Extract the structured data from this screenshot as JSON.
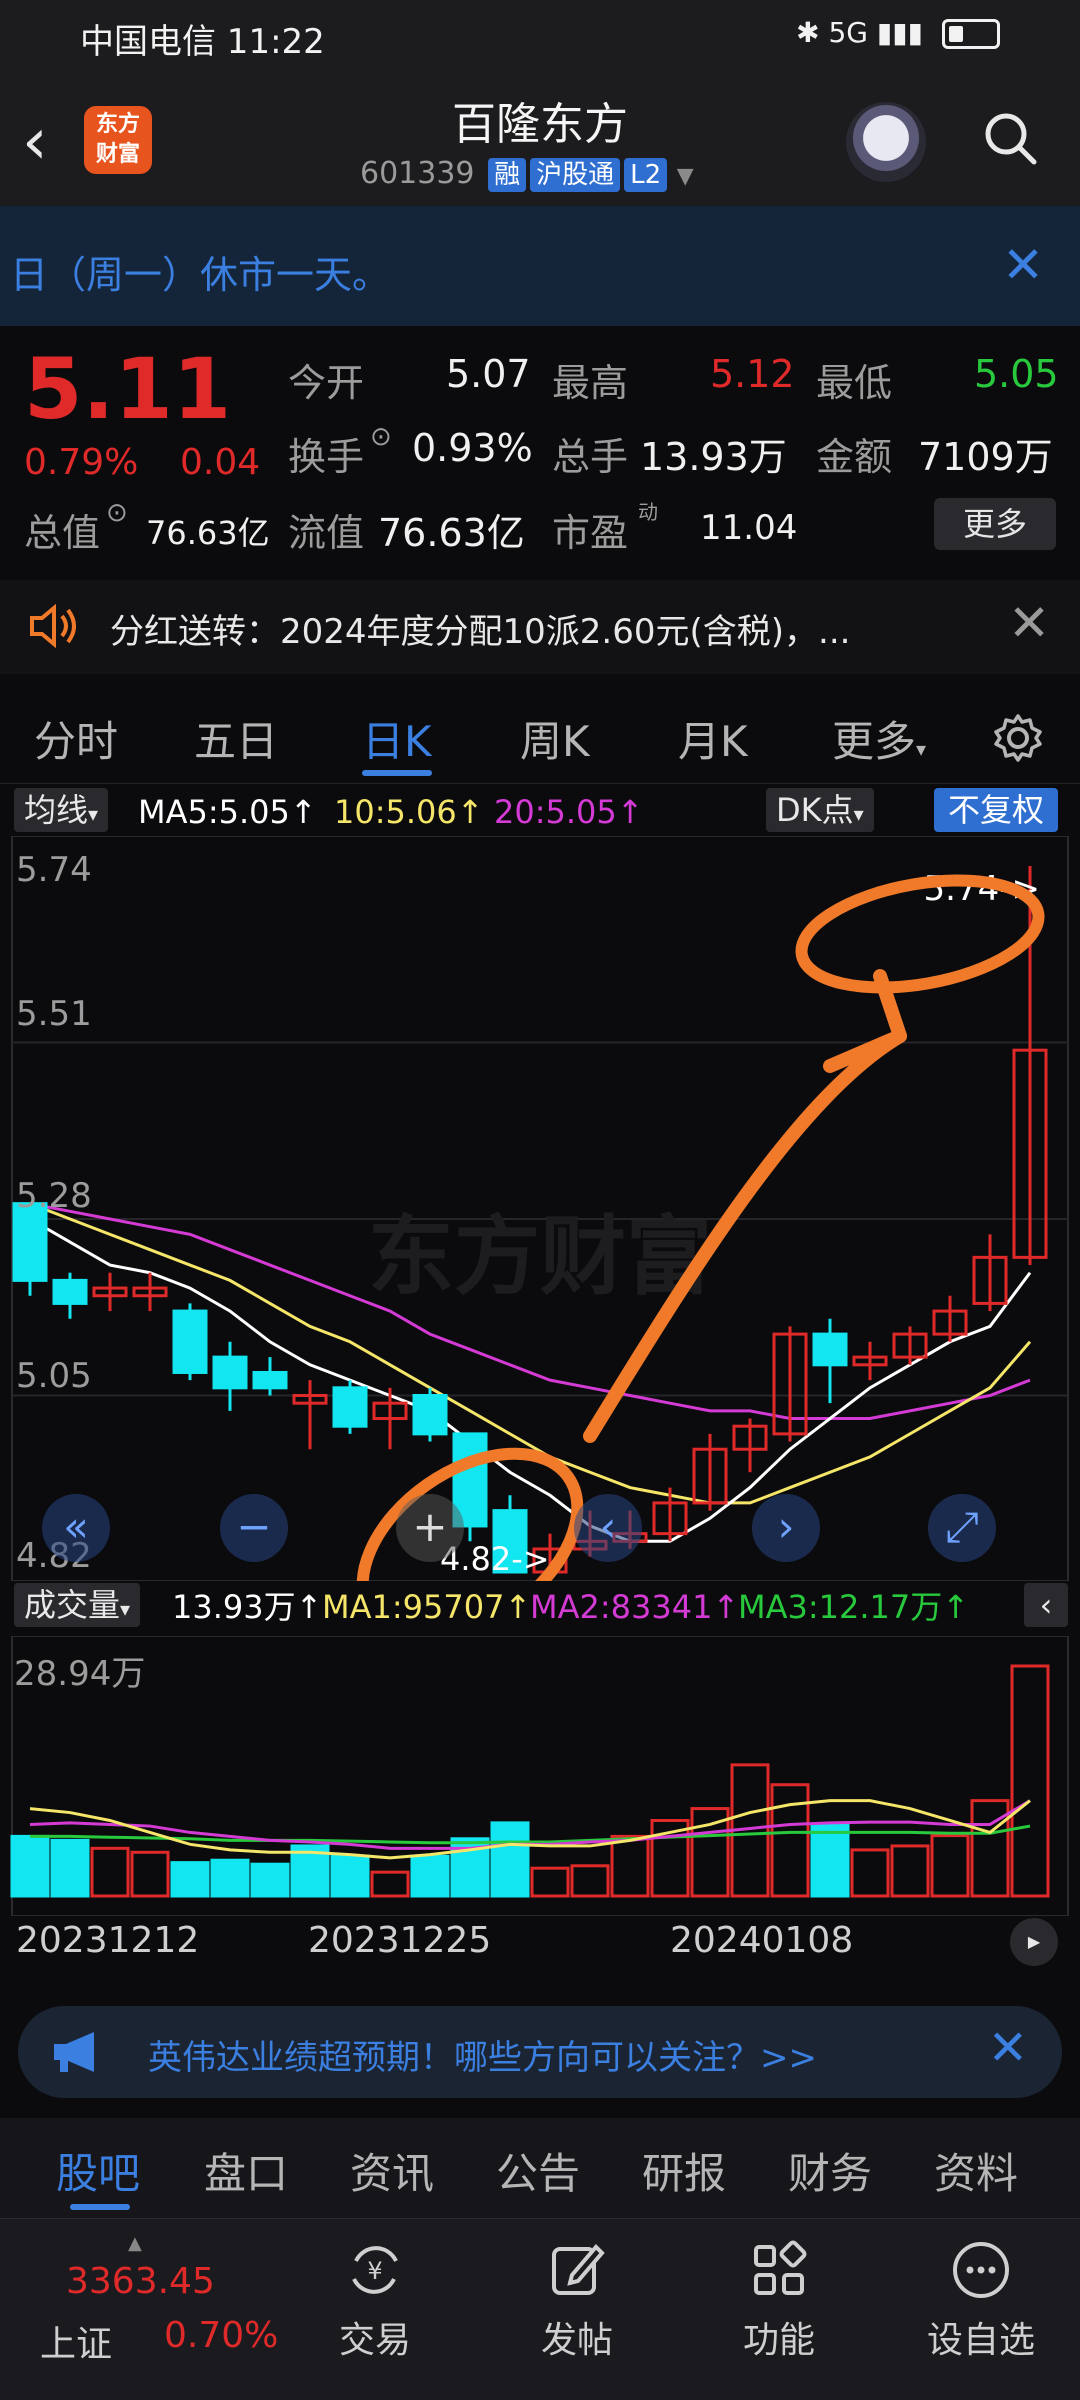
{
  "status_bar": {
    "carrier_time": "中国电信 11:22",
    "signal": "5G"
  },
  "header": {
    "logo_line1": "东方",
    "logo_line2": "财富",
    "title": "百隆东方",
    "code": "601339",
    "tags": [
      "融",
      "沪股通",
      "L2"
    ]
  },
  "notice": {
    "text": "日（周一）休市一天。"
  },
  "quote": {
    "price": "5.11",
    "pct": "0.79%",
    "change": "0.04",
    "open_label": "今开",
    "open": "5.07",
    "high_label": "最高",
    "high": "5.12",
    "low_label": "最低",
    "low": "5.05",
    "turnover_label": "换手",
    "turnover": "0.93%",
    "volume_label": "总手",
    "volume": "13.93万",
    "amount_label": "金额",
    "amount": "7109万",
    "mktcap_label": "总值",
    "mktcap": "76.63亿",
    "float_label": "流值",
    "float": "76.63亿",
    "pe_label": "市盈",
    "pe_sup": "动",
    "pe": "11.04",
    "more": "更多"
  },
  "dividend": {
    "text": "分红送转：2024年度分配10派2.60元(含税)，..."
  },
  "tabs": [
    "分时",
    "五日",
    "日K",
    "周K",
    "月K",
    "更多"
  ],
  "ma_bar": {
    "select": "均线",
    "ma5": "MA5:5.05",
    "ma10": "10:5.06",
    "ma20": "20:5.05",
    "dk": "DK点",
    "adjust": "不复权",
    "colors": {
      "ma5": "#ffffff",
      "ma10": "#f5e66a",
      "ma20": "#d43bd4",
      "up": "#e02a2a",
      "down": "#12e6f0"
    }
  },
  "vol_bar": {
    "select": "成交量",
    "vol": "13.93万",
    "ma1": "MA1:95707",
    "ma2": "MA2:83341",
    "ma3": "MA3:12.17万"
  },
  "chart_data": {
    "type": "candlestick",
    "yticks": [
      "5.74",
      "5.51",
      "5.28",
      "5.05",
      "4.82"
    ],
    "ylim": [
      4.82,
      5.74
    ],
    "max_label": "5.74->",
    "min_label": "4.82->",
    "watermark": "东方财富",
    "vol_max_label": "28.94万",
    "dates": [
      "20231212",
      "20231225",
      "20240108"
    ],
    "candles": [
      {
        "o": 5.3,
        "c": 5.2,
        "h": 5.3,
        "l": 5.18
      },
      {
        "o": 5.2,
        "c": 5.17,
        "h": 5.21,
        "l": 5.15
      },
      {
        "o": 5.18,
        "c": 5.19,
        "h": 5.21,
        "l": 5.16
      },
      {
        "o": 5.18,
        "c": 5.19,
        "h": 5.21,
        "l": 5.16
      },
      {
        "o": 5.16,
        "c": 5.08,
        "h": 5.17,
        "l": 5.07
      },
      {
        "o": 5.1,
        "c": 5.06,
        "h": 5.12,
        "l": 5.03
      },
      {
        "o": 5.08,
        "c": 5.06,
        "h": 5.1,
        "l": 5.05
      },
      {
        "o": 5.04,
        "c": 5.05,
        "h": 5.07,
        "l": 4.98
      },
      {
        "o": 5.06,
        "c": 5.01,
        "h": 5.07,
        "l": 5.0
      },
      {
        "o": 5.02,
        "c": 5.04,
        "h": 5.06,
        "l": 4.98
      },
      {
        "o": 5.05,
        "c": 5.0,
        "h": 5.06,
        "l": 4.99
      },
      {
        "o": 5.0,
        "c": 4.88,
        "h": 5.0,
        "l": 4.86
      },
      {
        "o": 4.9,
        "c": 4.82,
        "h": 4.92,
        "l": 4.82
      },
      {
        "o": 4.82,
        "c": 4.85,
        "h": 4.87,
        "l": 4.82
      },
      {
        "o": 4.85,
        "c": 4.86,
        "h": 4.9,
        "l": 4.84
      },
      {
        "o": 4.86,
        "c": 4.87,
        "h": 4.9,
        "l": 4.85
      },
      {
        "o": 4.87,
        "c": 4.91,
        "h": 4.93,
        "l": 4.86
      },
      {
        "o": 4.91,
        "c": 4.98,
        "h": 5.0,
        "l": 4.9
      },
      {
        "o": 4.98,
        "c": 5.01,
        "h": 5.02,
        "l": 4.95
      },
      {
        "o": 5.0,
        "c": 5.13,
        "h": 5.14,
        "l": 4.99
      },
      {
        "o": 5.13,
        "c": 5.09,
        "h": 5.15,
        "l": 5.04
      },
      {
        "o": 5.09,
        "c": 5.1,
        "h": 5.12,
        "l": 5.07
      },
      {
        "o": 5.1,
        "c": 5.13,
        "h": 5.14,
        "l": 5.09
      },
      {
        "o": 5.13,
        "c": 5.16,
        "h": 5.18,
        "l": 5.12
      },
      {
        "o": 5.17,
        "c": 5.23,
        "h": 5.26,
        "l": 5.16
      },
      {
        "o": 5.23,
        "c": 5.5,
        "h": 5.74,
        "l": 5.22
      }
    ],
    "ma5": [
      5.28,
      5.25,
      5.22,
      5.21,
      5.19,
      5.16,
      5.12,
      5.09,
      5.07,
      5.05,
      5.03,
      4.99,
      4.95,
      4.92,
      4.88,
      4.86,
      4.86,
      4.89,
      4.93,
      4.98,
      5.02,
      5.06,
      5.09,
      5.12,
      5.14,
      5.21
    ],
    "ma10": [
      5.3,
      5.28,
      5.26,
      5.24,
      5.22,
      5.2,
      5.17,
      5.14,
      5.12,
      5.09,
      5.06,
      5.03,
      5.0,
      4.97,
      4.95,
      4.93,
      4.92,
      4.91,
      4.91,
      4.93,
      4.95,
      4.97,
      5.0,
      5.03,
      5.06,
      5.12
    ],
    "ma20": [
      5.3,
      5.29,
      5.28,
      5.27,
      5.26,
      5.24,
      5.22,
      5.2,
      5.18,
      5.16,
      5.13,
      5.11,
      5.09,
      5.07,
      5.06,
      5.05,
      5.04,
      5.03,
      5.03,
      5.02,
      5.02,
      5.02,
      5.03,
      5.04,
      5.05,
      5.07
    ],
    "volumes": [
      7.5,
      7.0,
      6.0,
      5.5,
      4.2,
      4.5,
      4.0,
      6.3,
      5.0,
      3.0,
      5.0,
      7.2,
      9.2,
      3.5,
      3.8,
      7.5,
      9.5,
      11.0,
      16.5,
      14.0,
      9.0,
      5.8,
      6.3,
      7.6,
      12.0,
      28.94
    ],
    "vol_up": [
      false,
      false,
      true,
      true,
      false,
      false,
      false,
      false,
      false,
      true,
      false,
      false,
      false,
      true,
      true,
      true,
      true,
      true,
      true,
      true,
      false,
      true,
      true,
      true,
      true,
      true
    ],
    "vol_ma1": [
      11.0,
      10.5,
      9.5,
      8.0,
      6.5,
      5.8,
      5.5,
      5.5,
      5.2,
      4.8,
      5.2,
      5.8,
      6.5,
      6.3,
      6.3,
      7.0,
      8.0,
      9.0,
      10.5,
      11.5,
      12.0,
      12.0,
      11.0,
      9.5,
      8.0,
      12.0
    ],
    "vol_ma2": [
      9.0,
      9.2,
      9.0,
      8.8,
      8.0,
      7.5,
      7.0,
      6.8,
      6.5,
      6.0,
      6.0,
      6.0,
      6.5,
      6.5,
      6.8,
      7.0,
      7.5,
      8.0,
      8.5,
      9.0,
      9.2,
      9.3,
      9.3,
      9.0,
      9.0,
      12.0
    ],
    "vol_ma3": [
      7.5,
      7.5,
      7.4,
      7.3,
      7.2,
      7.0,
      7.0,
      7.0,
      6.9,
      6.8,
      6.7,
      6.7,
      6.8,
      6.8,
      7.0,
      7.2,
      7.4,
      7.6,
      7.8,
      8.0,
      8.0,
      8.0,
      8.0,
      7.9,
      7.9,
      8.8
    ]
  },
  "chart_controls": [
    "«",
    "−",
    "+",
    "‹",
    "›",
    "⤢"
  ],
  "ad": {
    "text": "英伟达业绩超预期！哪些方向可以关注？>>"
  },
  "bottom_tabs": [
    "股吧",
    "盘口",
    "资讯",
    "公告",
    "研报",
    "财务",
    "资料"
  ],
  "dock": {
    "index_value": "3363.45",
    "index_name": "上证",
    "index_pct": "0.70%",
    "items": [
      "交易",
      "发帖",
      "功能",
      "设自选"
    ]
  }
}
